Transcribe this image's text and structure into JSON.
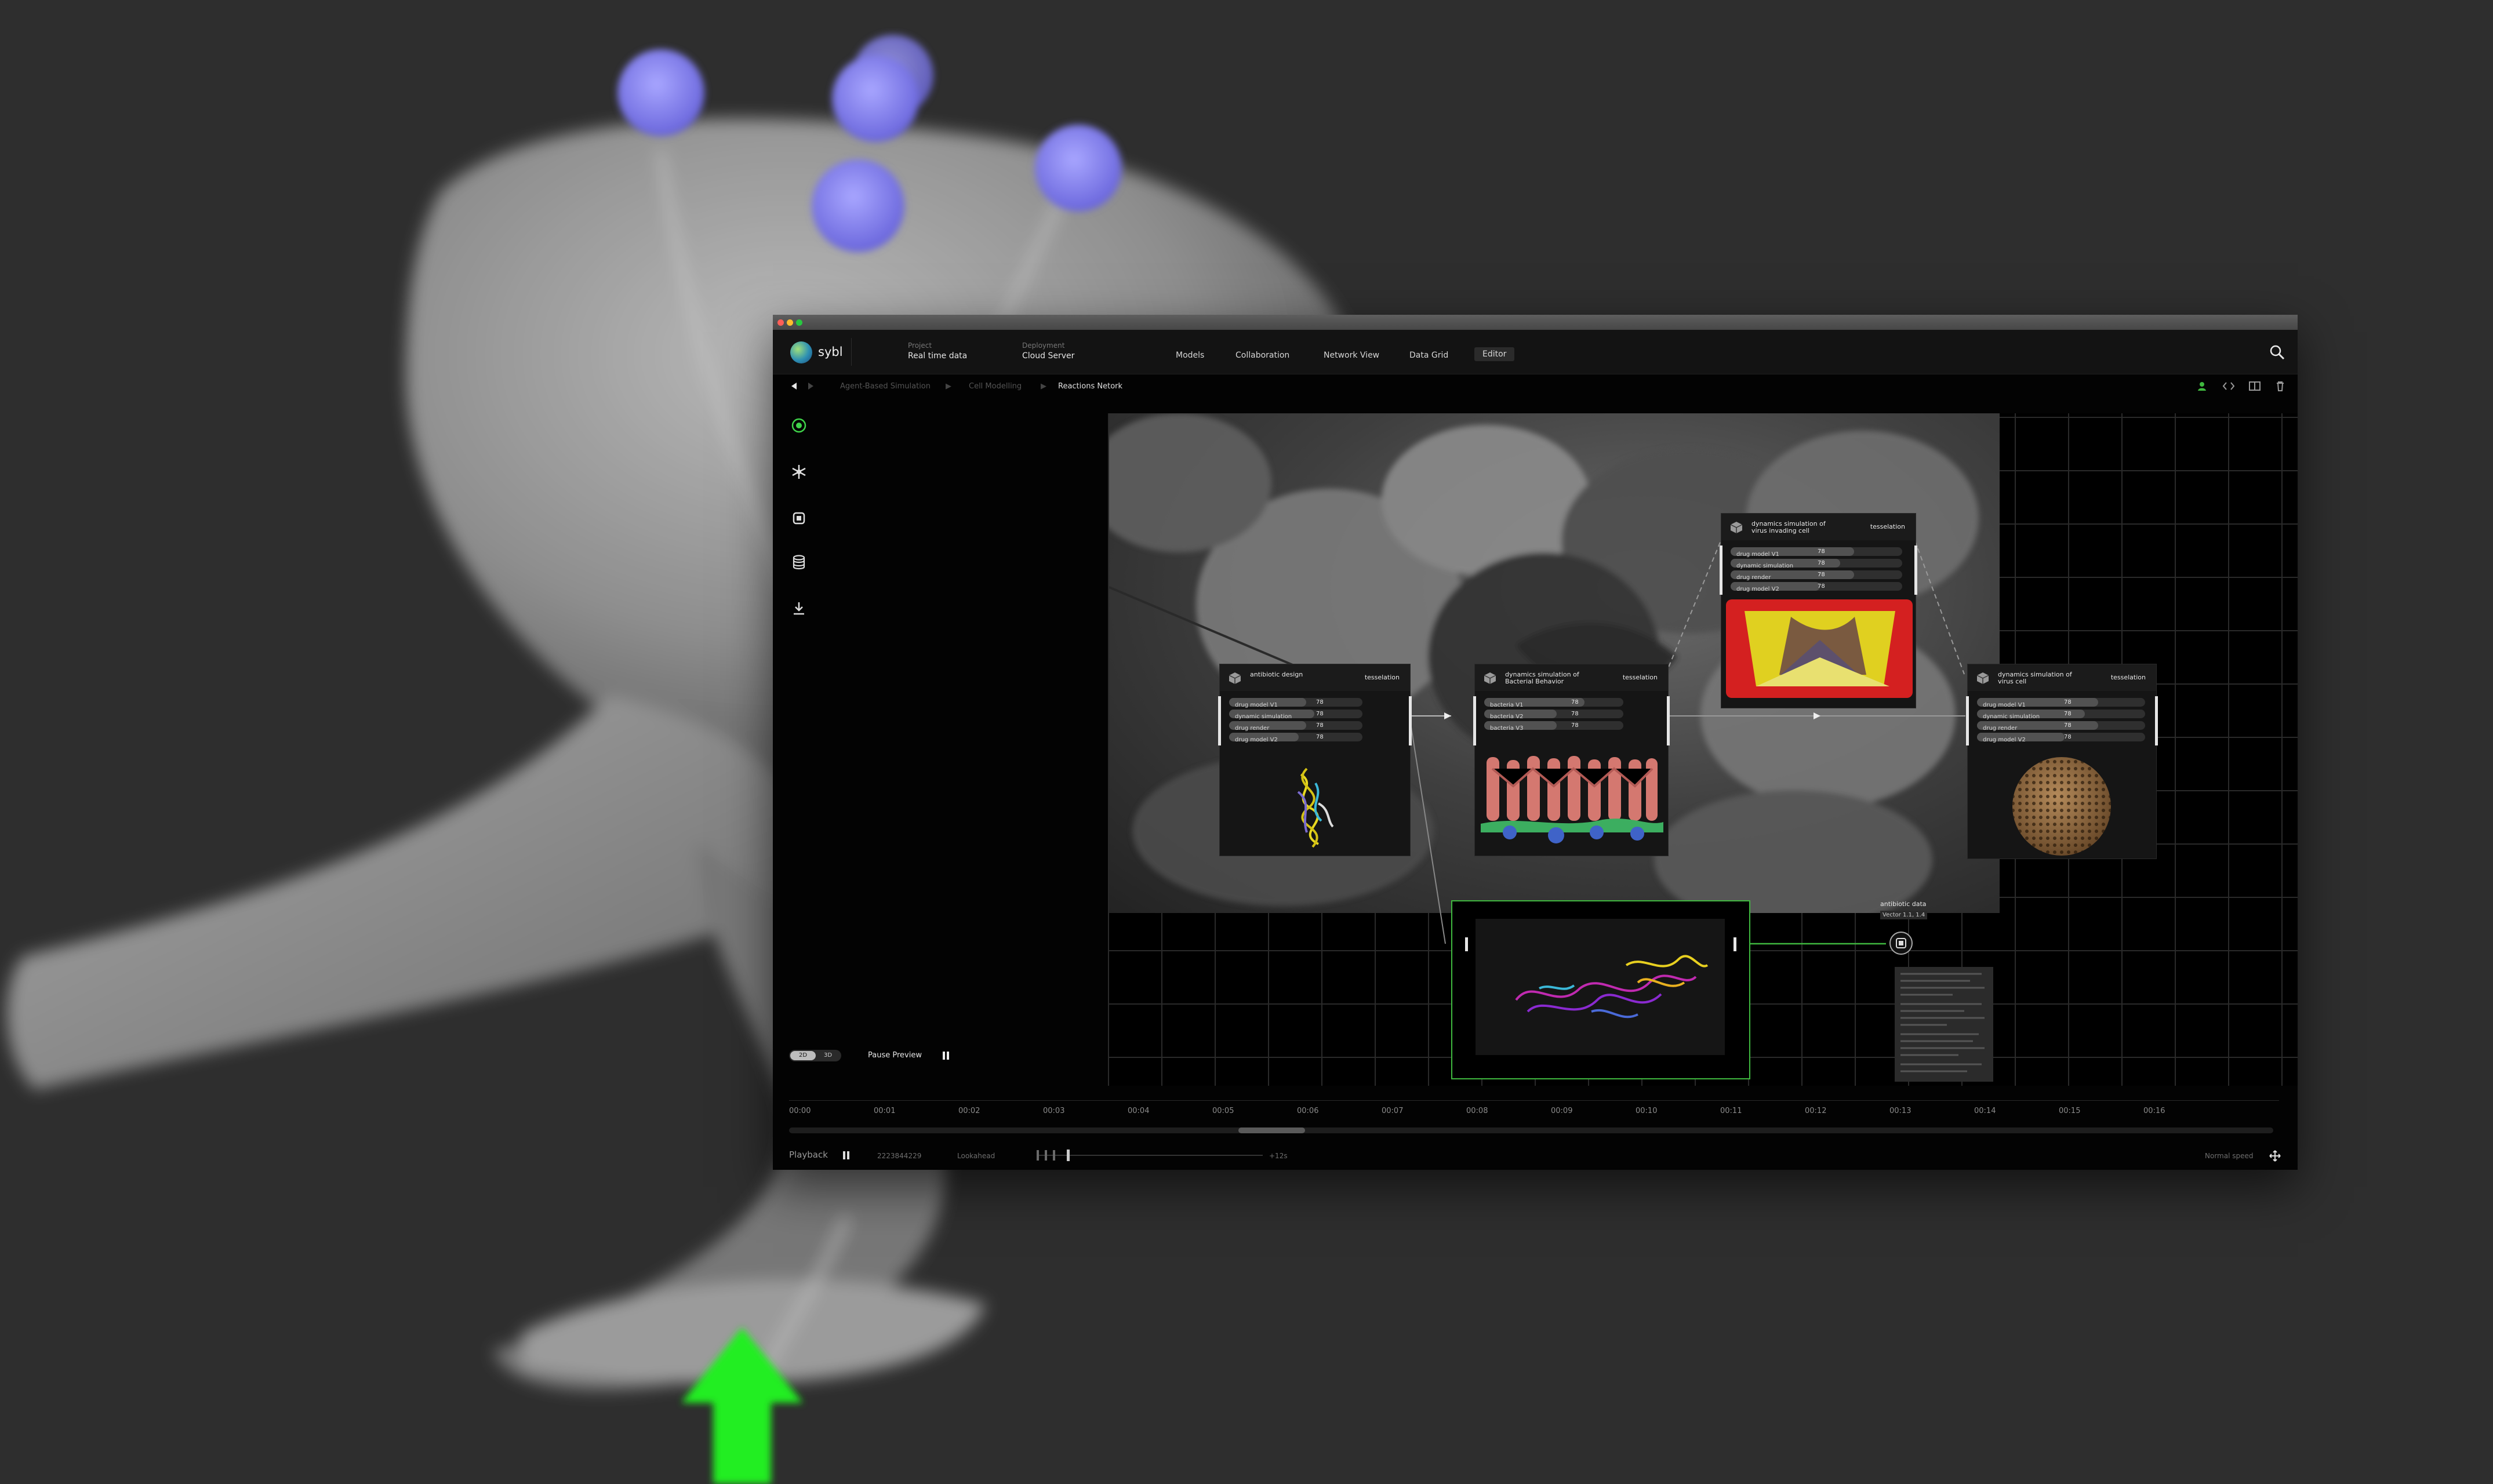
{
  "app": {
    "brand": "sybl",
    "project_label": "Project",
    "project_value": "Real time data",
    "deployment_label": "Deployment",
    "deployment_value": "Cloud Server"
  },
  "nav": [
    "Models",
    "Collaboration",
    "Network View",
    "Data Grid",
    "Editor"
  ],
  "nav_active": "Editor",
  "breadcrumb": [
    "Agent-Based Simulation",
    "Cell Modelling",
    "Reactions Netork"
  ],
  "sidebar_icons": [
    "target-icon",
    "snowflake-icon",
    "chip-icon",
    "database-icon",
    "download-icon"
  ],
  "toolbar_icons": [
    "user-icon",
    "code-icon",
    "layout-icon",
    "trash-icon"
  ],
  "nodes": {
    "n1": {
      "title": "antibiotic design",
      "tag": "tesselation",
      "rows": [
        {
          "label": "drug model V1",
          "value": "78",
          "level": 0.58
        },
        {
          "label": "dynamic simulation",
          "value": "78",
          "level": 0.64
        },
        {
          "label": "drug render",
          "value": "78",
          "level": 0.58
        },
        {
          "label": "drug model V2",
          "value": "78",
          "level": 0.52
        }
      ]
    },
    "n2": {
      "title": "dynamics simulation of Bacterial Behavior",
      "tag": "tesselation",
      "rows": [
        {
          "label": "bacteria V1",
          "value": "78",
          "level": 0.72
        },
        {
          "label": "bacteria V2",
          "value": "78",
          "level": 0.52
        },
        {
          "label": "bacteria V3",
          "value": "78",
          "level": 0.52
        }
      ]
    },
    "n3": {
      "title": "dynamics simulation of virus invading cell",
      "tag": "tesselation",
      "rows": [
        {
          "label": "drug model V1",
          "value": "78",
          "level": 0.72
        },
        {
          "label": "dynamic simulation",
          "value": "78",
          "level": 0.64
        },
        {
          "label": "drug render",
          "value": "78",
          "level": 0.72
        },
        {
          "label": "drug model V2",
          "value": "78",
          "level": 0.52
        }
      ]
    },
    "n4": {
      "title": "dynamics simulation of virus cell",
      "tag": "tesselation",
      "rows": [
        {
          "label": "drug model V1",
          "value": "78",
          "level": 0.72
        },
        {
          "label": "dynamic simulation",
          "value": "78",
          "level": 0.64
        },
        {
          "label": "drug render",
          "value": "78",
          "level": 0.72
        },
        {
          "label": "drug model V2",
          "value": "78",
          "level": 0.52
        }
      ]
    }
  },
  "data_node": {
    "title": "antibiotic data",
    "subtitle": "Vector 1.1, 1.4"
  },
  "view_toggle": [
    "2D",
    "3D"
  ],
  "pause_preview": "Pause Preview",
  "timeline": {
    "ticks": [
      "00:00",
      "00:01",
      "00:02",
      "00:03",
      "00:04",
      "00:05",
      "00:06",
      "00:07",
      "00:08",
      "00:09",
      "00:10",
      "00:11",
      "00:12",
      "00:13",
      "00:14",
      "00:15",
      "00:16"
    ],
    "playback": "Playback",
    "frame": "2223844229",
    "lookahead": "Lookahead",
    "lookahead_value": "+12s",
    "speed": "Normal speed"
  },
  "colors": {
    "accent_green": "#3fb83f",
    "orb": "#8c88ee",
    "arrow": "#22ee22"
  }
}
